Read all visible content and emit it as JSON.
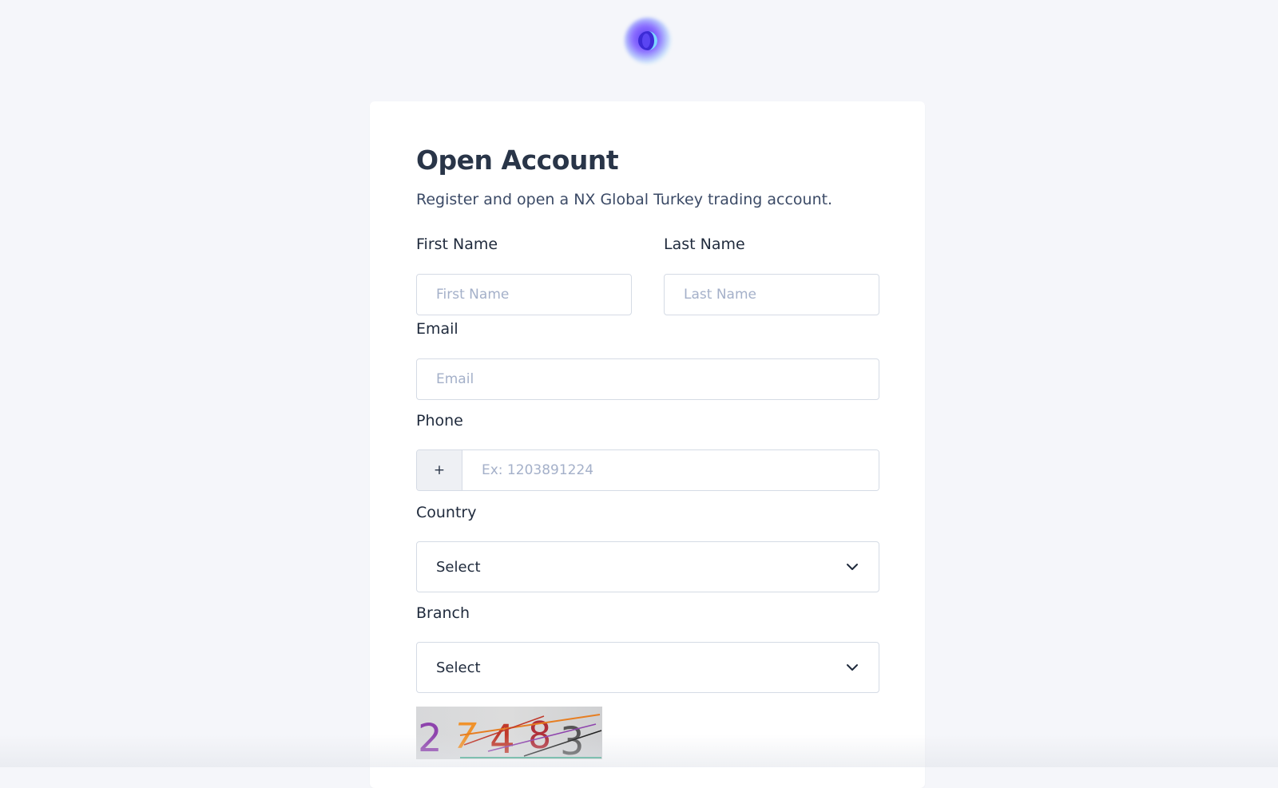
{
  "form": {
    "title": "Open Account",
    "subtitle": "Register and open a NX Global Turkey trading account.",
    "first_name": {
      "label": "First Name",
      "placeholder": "First Name"
    },
    "last_name": {
      "label": "Last Name",
      "placeholder": "Last Name"
    },
    "email": {
      "label": "Email",
      "placeholder": "Email"
    },
    "phone": {
      "label": "Phone",
      "prefix": "+",
      "placeholder": "Ex: 1203891224"
    },
    "country": {
      "label": "Country",
      "selected": "Select"
    },
    "branch": {
      "label": "Branch",
      "selected": "Select"
    },
    "captcha": {
      "digits": [
        "2",
        "7",
        "4",
        "8",
        "3"
      ]
    }
  },
  "colors": {
    "page_bg": "#f5f6fa",
    "card_bg": "#ffffff",
    "title": "#293548",
    "placeholder": "#a4b0c9",
    "border": "#d5dbe5",
    "brand": "#5b3df5"
  },
  "icons": {
    "logo": "brand-logo-icon",
    "dropdown": "chevron-down-icon"
  }
}
